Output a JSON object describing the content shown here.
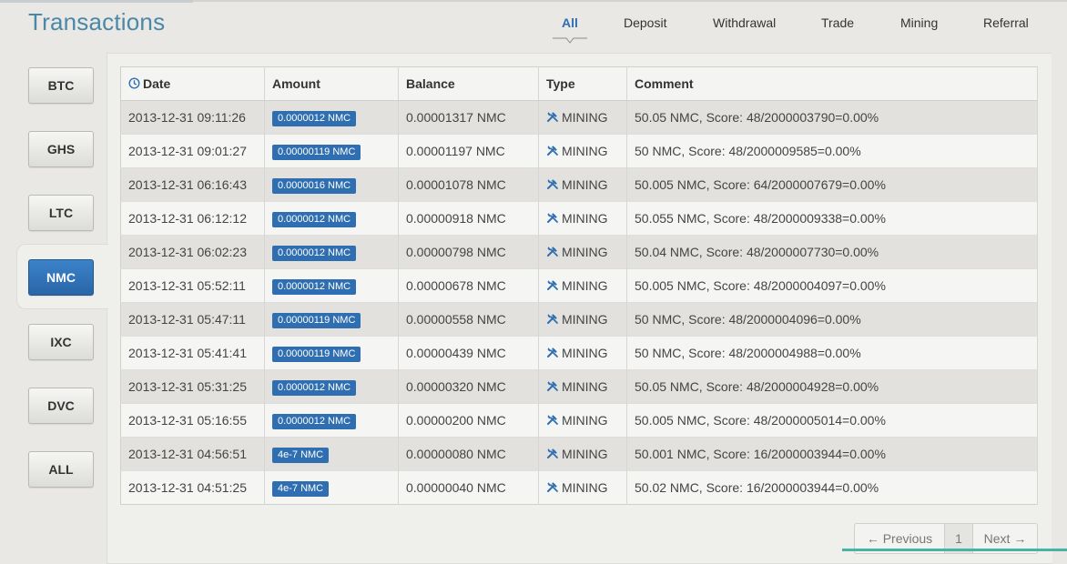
{
  "header": {
    "title": "Transactions"
  },
  "tabs": [
    {
      "label": "All",
      "active": true
    },
    {
      "label": "Deposit",
      "active": false
    },
    {
      "label": "Withdrawal",
      "active": false
    },
    {
      "label": "Trade",
      "active": false
    },
    {
      "label": "Mining",
      "active": false
    },
    {
      "label": "Referral",
      "active": false
    }
  ],
  "sidebar": {
    "items": [
      {
        "label": "BTC",
        "active": false
      },
      {
        "label": "GHS",
        "active": false
      },
      {
        "label": "LTC",
        "active": false
      },
      {
        "label": "NMC",
        "active": true
      },
      {
        "label": "IXC",
        "active": false
      },
      {
        "label": "DVC",
        "active": false
      },
      {
        "label": "ALL",
        "active": false
      }
    ]
  },
  "table": {
    "headers": {
      "date": "Date",
      "amount": "Amount",
      "balance": "Balance",
      "type": "Type",
      "comment": "Comment"
    },
    "rows": [
      {
        "date": "2013-12-31 09:11:26",
        "amount": "0.0000012 NMC",
        "balance": "0.00001317 NMC",
        "type": "MINING",
        "comment": "50.05 NMC, Score: 48/2000003790=0.00%"
      },
      {
        "date": "2013-12-31 09:01:27",
        "amount": "0.00000119 NMC",
        "balance": "0.00001197 NMC",
        "type": "MINING",
        "comment": "50 NMC, Score: 48/2000009585=0.00%"
      },
      {
        "date": "2013-12-31 06:16:43",
        "amount": "0.0000016 NMC",
        "balance": "0.00001078 NMC",
        "type": "MINING",
        "comment": "50.005 NMC, Score: 64/2000007679=0.00%"
      },
      {
        "date": "2013-12-31 06:12:12",
        "amount": "0.0000012 NMC",
        "balance": "0.00000918 NMC",
        "type": "MINING",
        "comment": "50.055 NMC, Score: 48/2000009338=0.00%"
      },
      {
        "date": "2013-12-31 06:02:23",
        "amount": "0.0000012 NMC",
        "balance": "0.00000798 NMC",
        "type": "MINING",
        "comment": "50.04 NMC, Score: 48/2000007730=0.00%"
      },
      {
        "date": "2013-12-31 05:52:11",
        "amount": "0.0000012 NMC",
        "balance": "0.00000678 NMC",
        "type": "MINING",
        "comment": "50.005 NMC, Score: 48/2000004097=0.00%"
      },
      {
        "date": "2013-12-31 05:47:11",
        "amount": "0.00000119 NMC",
        "balance": "0.00000558 NMC",
        "type": "MINING",
        "comment": "50 NMC, Score: 48/2000004096=0.00%"
      },
      {
        "date": "2013-12-31 05:41:41",
        "amount": "0.00000119 NMC",
        "balance": "0.00000439 NMC",
        "type": "MINING",
        "comment": "50 NMC, Score: 48/2000004988=0.00%"
      },
      {
        "date": "2013-12-31 05:31:25",
        "amount": "0.0000012 NMC",
        "balance": "0.00000320 NMC",
        "type": "MINING",
        "comment": "50.05 NMC, Score: 48/2000004928=0.00%"
      },
      {
        "date": "2013-12-31 05:16:55",
        "amount": "0.0000012 NMC",
        "balance": "0.00000200 NMC",
        "type": "MINING",
        "comment": "50.005 NMC, Score: 48/2000005014=0.00%"
      },
      {
        "date": "2013-12-31 04:56:51",
        "amount": "4e-7 NMC",
        "balance": "0.00000080 NMC",
        "type": "MINING",
        "comment": "50.001 NMC, Score: 16/2000003944=0.00%"
      },
      {
        "date": "2013-12-31 04:51:25",
        "amount": "4e-7 NMC",
        "balance": "0.00000040 NMC",
        "type": "MINING",
        "comment": "50.02 NMC, Score: 16/2000003944=0.00%"
      }
    ]
  },
  "pagination": {
    "previous": "← Previous",
    "current": "1",
    "next": "Next →"
  },
  "icons": {
    "date_header": "clock-icon",
    "type_cell": "tools-icon"
  },
  "colors": {
    "accent": "#2f6fb1",
    "title": "#4a88a8",
    "active_button": "#2f6fb1",
    "bottom_bar": "#48b3a4"
  }
}
